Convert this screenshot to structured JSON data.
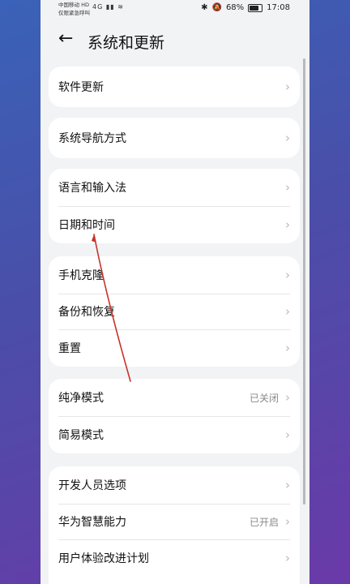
{
  "status_bar": {
    "carrier_line1": "中国移动 HD",
    "carrier_line2": "仅限紧急呼叫",
    "signal": "4G",
    "battery": "68%",
    "time": "17:08"
  },
  "header": {
    "title": "系统和更新"
  },
  "groups": [
    {
      "items": [
        {
          "label": "软件更新",
          "value": ""
        }
      ]
    },
    {
      "items": [
        {
          "label": "系统导航方式",
          "value": ""
        }
      ]
    },
    {
      "items": [
        {
          "label": "语言和输入法",
          "value": ""
        },
        {
          "label": "日期和时间",
          "value": ""
        }
      ]
    },
    {
      "items": [
        {
          "label": "手机克隆",
          "value": ""
        },
        {
          "label": "备份和恢复",
          "value": ""
        },
        {
          "label": "重置",
          "value": ""
        }
      ]
    },
    {
      "items": [
        {
          "label": "纯净模式",
          "value": "已关闭"
        },
        {
          "label": "简易模式",
          "value": ""
        }
      ]
    },
    {
      "items": [
        {
          "label": "开发人员选项",
          "value": ""
        },
        {
          "label": "华为智慧能力",
          "value": "已开启"
        },
        {
          "label": "用户体验改进计划",
          "value": ""
        }
      ]
    }
  ],
  "icons": {
    "back": "back-arrow-icon",
    "chevron": "chevron-right-icon"
  },
  "colors": {
    "annotation_stroke": "#c8312a"
  }
}
